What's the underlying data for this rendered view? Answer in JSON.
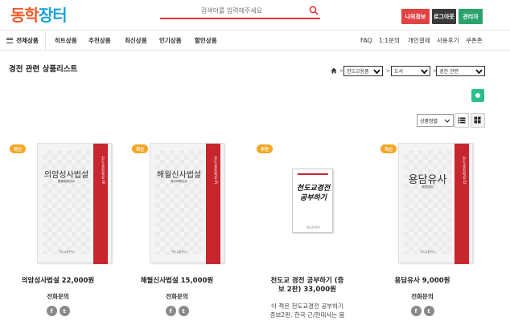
{
  "header": {
    "logo_part1": "동학",
    "logo_part2": "장터",
    "search_placeholder": "검색어를 입력해주세요",
    "buttons": [
      "나의정보",
      "로그아웃",
      "관리자"
    ]
  },
  "nav": {
    "all_categories": "전체상품",
    "menu": [
      "히트상품",
      "추천상품",
      "최신상품",
      "인기상품",
      "할인상품"
    ],
    "right_menu": [
      "FAQ",
      "1:1문의",
      "개인결제",
      "사용후기",
      "쿠폰존"
    ]
  },
  "page_title": "경전 관련 상품리스트",
  "breadcrumb": [
    "천도교용품",
    "도서",
    "경전 관련"
  ],
  "sort_label": "상품정렬",
  "products": [
    {
      "badge": "최신",
      "cover_title": "의암성사법설",
      "cover_sub": "義菴聖師法說",
      "spine_text": "천도교경전해설 06",
      "name": "의암성사법설 22,000원",
      "phone": "전화문의"
    },
    {
      "badge": "최신",
      "cover_title": "해월신사법설",
      "cover_sub": "海月神師法說",
      "spine_text": "천도교경전해설 05",
      "name": "해월신사법설 15,000원",
      "phone": "전화문의"
    },
    {
      "badge": "추천",
      "cover_title": "천도교경전 공부하기",
      "name_line1": "천도교 경전 공부하기 (증",
      "name_line2": "보 2판) 33,000원",
      "desc_line1": "이 책은 천도교경전 공부하기",
      "desc_line2": "증보2판. 한국 근/현대사는 몸"
    },
    {
      "badge": "최신",
      "cover_title": "용담유사",
      "cover_sub": "龍潭遺詞",
      "spine_text": "천도교경전해설 02",
      "name": "용담유사 9,000원",
      "phone": "전화문의"
    }
  ],
  "social": [
    "f",
    "t"
  ],
  "colors": {
    "logo_orange": "#f25c2b",
    "logo_blue": "#1aa3d8",
    "search_red": "#e7343a",
    "btn_red": "#e14242",
    "btn_dark": "#3a3a3a",
    "btn_green": "#2aa36b",
    "badge_orange": "#f5a623",
    "spine_red": "#c8262f"
  }
}
